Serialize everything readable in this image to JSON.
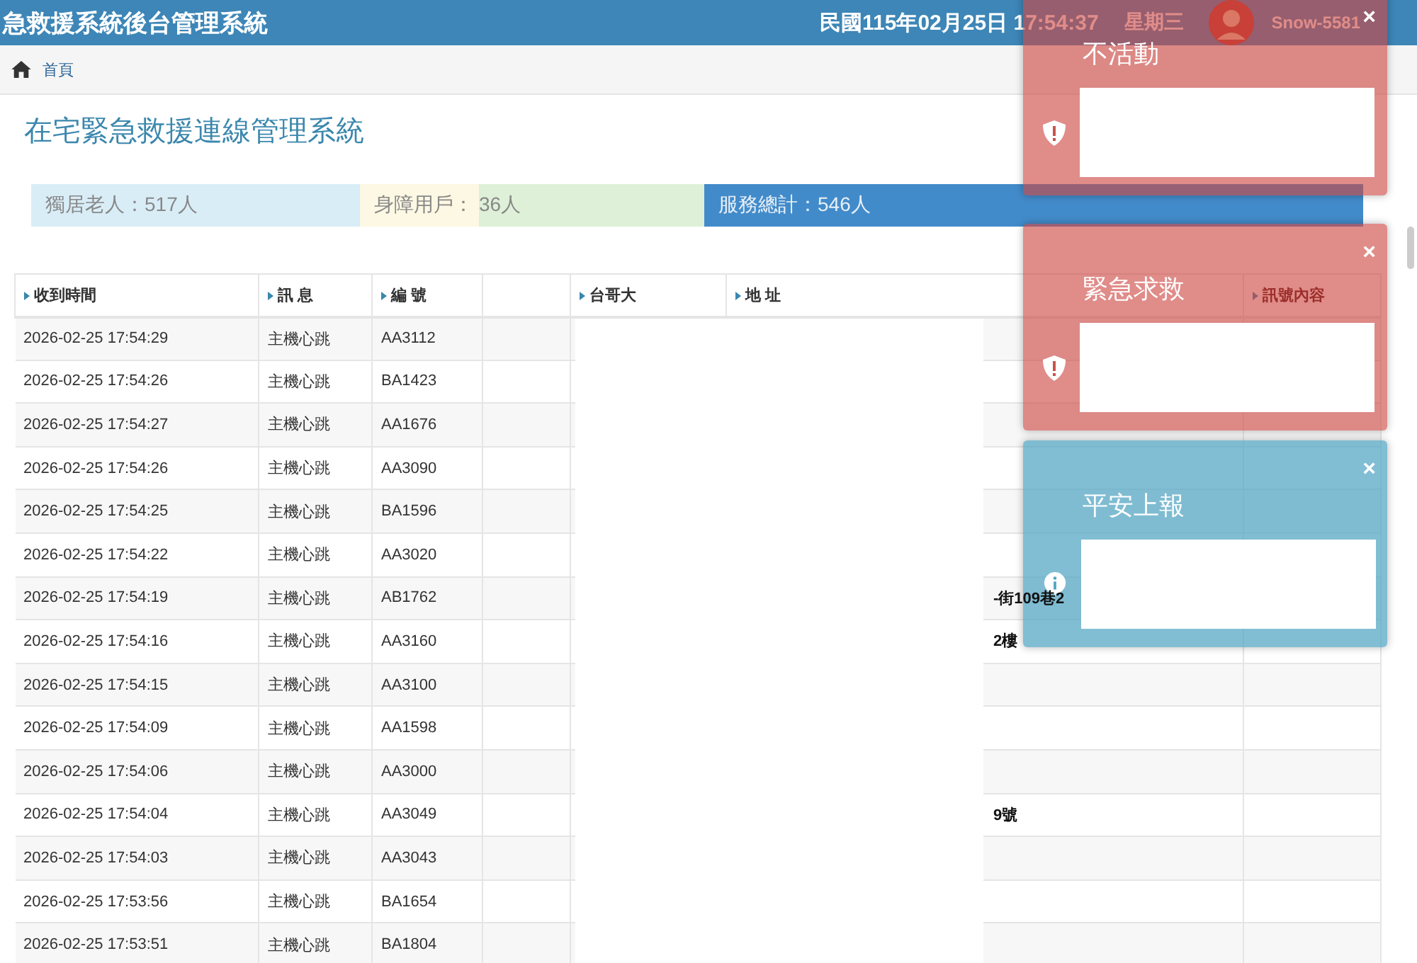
{
  "header": {
    "title": "急救援系統後台管理系統",
    "datetime": "民國115年02月25日 17:54:37",
    "weekday": "星期三",
    "user": "Snow-5581"
  },
  "breadcrumb": {
    "label": "首頁"
  },
  "page_title": "在宅緊急救援連線管理系統",
  "stats": [
    {
      "label": "獨居老人：517人",
      "color": "#d9edf7"
    },
    {
      "label": "身障用戶：",
      "color": "#fcf8e3"
    },
    {
      "label": "36人",
      "color": "#dff0d8"
    },
    {
      "label": "服務總計：546人",
      "color": "#428bca"
    }
  ],
  "table": {
    "columns": [
      "收到時間",
      "訊 息",
      "編 號",
      "",
      "台哥大",
      "地 址",
      "",
      "訊號內容"
    ],
    "rows": [
      {
        "time": "2026-02-25 17:54:29",
        "message": "主機心跳",
        "id": "AA3112"
      },
      {
        "time": "2026-02-25 17:54:26",
        "message": "主機心跳",
        "id": "BA1423"
      },
      {
        "time": "2026-02-25 17:54:27",
        "message": "主機心跳",
        "id": "AA1676"
      },
      {
        "time": "2026-02-25 17:54:26",
        "message": "主機心跳",
        "id": "AA3090"
      },
      {
        "time": "2026-02-25 17:54:25",
        "message": "主機心跳",
        "id": "BA1596"
      },
      {
        "time": "2026-02-25 17:54:22",
        "message": "主機心跳",
        "id": "AA3020"
      },
      {
        "time": "2026-02-25 17:54:19",
        "message": "主機心跳",
        "id": "AB1762",
        "address": "-街109巷2"
      },
      {
        "time": "2026-02-25 17:54:16",
        "message": "主機心跳",
        "id": "AA3160",
        "address": "2樓"
      },
      {
        "time": "2026-02-25 17:54:15",
        "message": "主機心跳",
        "id": "AA3100"
      },
      {
        "time": "2026-02-25 17:54:09",
        "message": "主機心跳",
        "id": "AA1598"
      },
      {
        "time": "2026-02-25 17:54:06",
        "message": "主機心跳",
        "id": "AA3000"
      },
      {
        "time": "2026-02-25 17:54:04",
        "message": "主機心跳",
        "id": "AA3049",
        "address": "9號"
      },
      {
        "time": "2026-02-25 17:54:03",
        "message": "主機心跳",
        "id": "AA3043"
      },
      {
        "time": "2026-02-25 17:53:56",
        "message": "主機心跳",
        "id": "BA1654"
      },
      {
        "time": "2026-02-25 17:53:51",
        "message": "主機心跳",
        "id": "BA1804"
      }
    ]
  },
  "notifications": [
    {
      "kind": "warning",
      "title": "不活動",
      "close": "×"
    },
    {
      "kind": "warning",
      "title": "緊急求救",
      "close": "×"
    },
    {
      "kind": "info",
      "title": "平安上報",
      "close": "×"
    }
  ]
}
